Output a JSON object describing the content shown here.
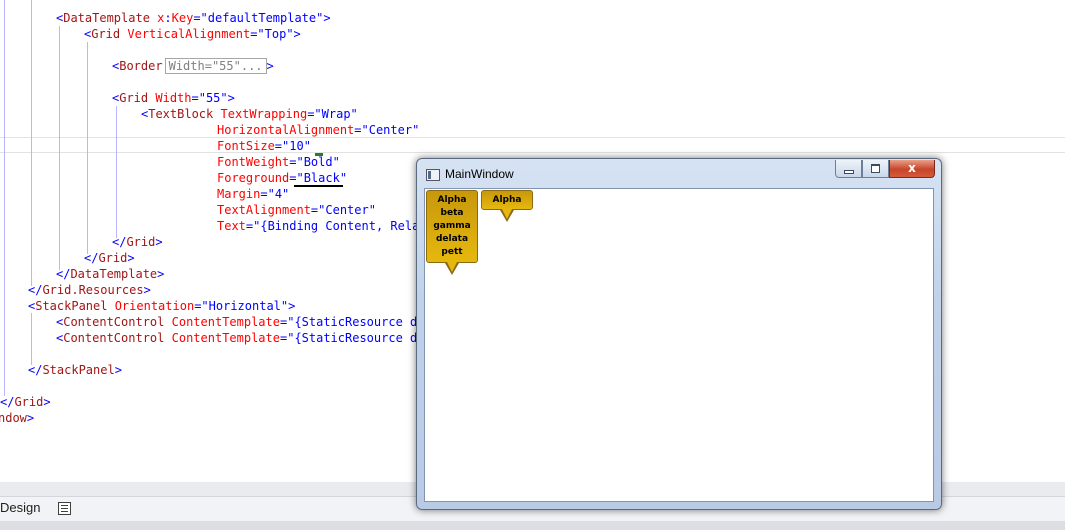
{
  "editor": {
    "lines": [
      [
        {
          "c": "bracket",
          "t": "<"
        },
        {
          "c": "tag",
          "t": "DataTemplate"
        },
        {
          "c": "attr",
          "t": " x"
        },
        {
          "c": "bracket",
          "t": ":"
        },
        {
          "c": "attr",
          "t": "Key"
        },
        {
          "c": "bracket",
          "t": "=\""
        },
        {
          "c": "val",
          "t": "defaultTemplate"
        },
        {
          "c": "bracket",
          "t": "\">"
        }
      ],
      [
        {
          "c": "bracket",
          "t": "<"
        },
        {
          "c": "tag",
          "t": "Grid"
        },
        {
          "c": "attr",
          "t": " VerticalAlignment"
        },
        {
          "c": "bracket",
          "t": "=\""
        },
        {
          "c": "val",
          "t": "Top"
        },
        {
          "c": "bracket",
          "t": "\">"
        }
      ],
      [
        {
          "c": "bracket",
          "t": "<"
        },
        {
          "c": "tag",
          "t": "Border"
        }
      ],
      [
        {
          "c": "bracket",
          "t": "<"
        },
        {
          "c": "tag",
          "t": "Grid"
        },
        {
          "c": "attr",
          "t": " Width"
        },
        {
          "c": "bracket",
          "t": "=\""
        },
        {
          "c": "val",
          "t": "55"
        },
        {
          "c": "bracket",
          "t": "\">"
        }
      ],
      [
        {
          "c": "bracket",
          "t": "<"
        },
        {
          "c": "tag",
          "t": "TextBlock"
        },
        {
          "c": "attr",
          "t": " TextWrapping"
        },
        {
          "c": "bracket",
          "t": "=\""
        },
        {
          "c": "val",
          "t": "Wrap"
        },
        {
          "c": "bracket",
          "t": "\""
        }
      ],
      [
        {
          "c": "attr",
          "t": "HorizontalAlignment"
        },
        {
          "c": "bracket",
          "t": "=\""
        },
        {
          "c": "val",
          "t": "Center"
        },
        {
          "c": "bracket",
          "t": "\""
        }
      ],
      [
        {
          "c": "attr",
          "t": "FontSize"
        },
        {
          "c": "bracket",
          "t": "=\""
        },
        {
          "c": "val",
          "t": "10"
        },
        {
          "c": "bracket",
          "t": "\""
        }
      ],
      [
        {
          "c": "attr",
          "t": "FontWeight"
        },
        {
          "c": "bracket",
          "t": "=\""
        },
        {
          "c": "val",
          "t": "Bold"
        },
        {
          "c": "bracket",
          "t": "\""
        }
      ],
      [
        {
          "c": "attr",
          "t": "Foreground"
        },
        {
          "c": "bracket",
          "t": "=\""
        },
        {
          "c": "val",
          "t": "Black"
        },
        {
          "c": "bracket",
          "t": "\""
        }
      ],
      [
        {
          "c": "attr",
          "t": "Margin"
        },
        {
          "c": "bracket",
          "t": "=\""
        },
        {
          "c": "val",
          "t": "4"
        },
        {
          "c": "bracket",
          "t": "\""
        }
      ],
      [
        {
          "c": "attr",
          "t": "TextAlignment"
        },
        {
          "c": "bracket",
          "t": "=\""
        },
        {
          "c": "val",
          "t": "Center"
        },
        {
          "c": "bracket",
          "t": "\""
        }
      ],
      [
        {
          "c": "attr",
          "t": "Text"
        },
        {
          "c": "bracket",
          "t": "=\""
        },
        {
          "c": "val",
          "t": "{Binding Content, Rela"
        }
      ],
      [
        {
          "c": "bracket",
          "t": "</"
        },
        {
          "c": "tag",
          "t": "Grid"
        },
        {
          "c": "bracket",
          "t": ">"
        }
      ],
      [
        {
          "c": "bracket",
          "t": "</"
        },
        {
          "c": "tag",
          "t": "Grid"
        },
        {
          "c": "bracket",
          "t": ">"
        }
      ],
      [
        {
          "c": "bracket",
          "t": "</"
        },
        {
          "c": "tag",
          "t": "DataTemplate"
        },
        {
          "c": "bracket",
          "t": ">"
        }
      ],
      [
        {
          "c": "bracket",
          "t": "</"
        },
        {
          "c": "tag",
          "t": "Grid.Resources"
        },
        {
          "c": "bracket",
          "t": ">"
        }
      ],
      [
        {
          "c": "bracket",
          "t": "<"
        },
        {
          "c": "tag",
          "t": "StackPanel"
        },
        {
          "c": "attr",
          "t": " Orientation"
        },
        {
          "c": "bracket",
          "t": "=\""
        },
        {
          "c": "val",
          "t": "Horizontal"
        },
        {
          "c": "bracket",
          "t": "\">"
        }
      ],
      [
        {
          "c": "bracket",
          "t": "<"
        },
        {
          "c": "tag",
          "t": "ContentControl"
        },
        {
          "c": "attr",
          "t": " ContentTemplate"
        },
        {
          "c": "bracket",
          "t": "=\""
        },
        {
          "c": "val",
          "t": "{StaticResource def"
        }
      ],
      [
        {
          "c": "bracket",
          "t": "<"
        },
        {
          "c": "tag",
          "t": "ContentControl"
        },
        {
          "c": "attr",
          "t": " ContentTemplate"
        },
        {
          "c": "bracket",
          "t": "=\""
        },
        {
          "c": "val",
          "t": "{StaticResource def"
        }
      ],
      [
        {
          "c": "bracket",
          "t": "</"
        },
        {
          "c": "tag",
          "t": "StackPanel"
        },
        {
          "c": "bracket",
          "t": ">"
        }
      ],
      [
        {
          "c": "bracket",
          "t": "</"
        },
        {
          "c": "tag",
          "t": "Grid"
        },
        {
          "c": "bracket",
          "t": ">"
        }
      ],
      [
        {
          "c": "tag",
          "t": "ndow"
        },
        {
          "c": "bracket",
          "t": ">"
        }
      ]
    ],
    "border_collapsed": {
      "text": "Width=\"55\"...",
      "close": ">"
    }
  },
  "footer": {
    "design_tab": "Design",
    "xaml_toggle_icon": "xaml-view-icon"
  },
  "window": {
    "title": "MainWindow",
    "close_symbol": "x",
    "bubbles": [
      {
        "lines": [
          "Alpha",
          "beta",
          "gamma",
          "delata",
          "pett"
        ]
      },
      {
        "lines": [
          "Alpha"
        ]
      }
    ]
  },
  "colors": {
    "tag": "#a31515",
    "attribute": "#ff0000",
    "value": "#0000ff",
    "bubble": "#e6b80d"
  }
}
